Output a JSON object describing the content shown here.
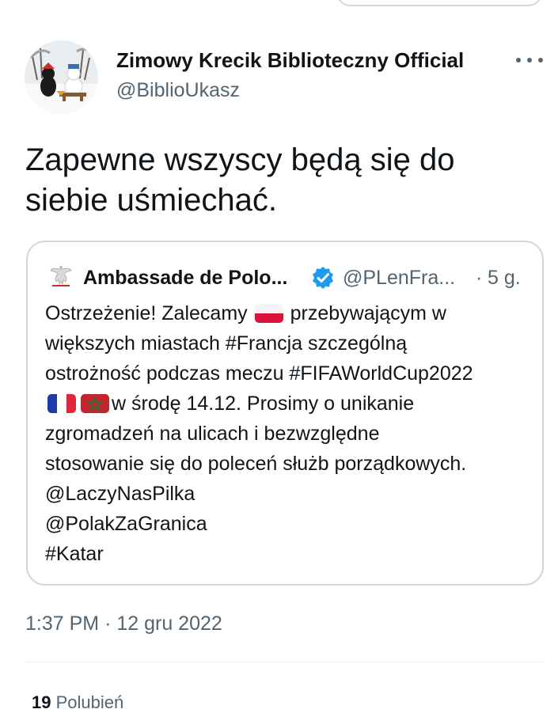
{
  "tweet": {
    "display_name": "Zimowy Krecik Biblioteczny Official",
    "handle": "@BiblioUkasz",
    "text": "Zapewne wszyscy będą się do siebie uśmiechać.",
    "time": "1:37 PM",
    "separator": "·",
    "date": "12 gru 2022",
    "likes_count": "19",
    "likes_label": "Polubień"
  },
  "quoted": {
    "display_name": "Ambassade de Polo...",
    "handle": "@PLenFra...",
    "separator": "·",
    "time": "5 g.",
    "lines": [
      {
        "pre": "Ostrzeżenie! Zalecamy",
        "post": "przebywającym w"
      },
      {
        "text": "większych miastach #Francja szczególną"
      },
      {
        "text": "ostrożność podczas meczu #FIFAWorldCup2022"
      },
      {
        "post": "w środę 14.12. Prosimy o unikanie"
      },
      {
        "text": "zgromadzeń na ulicach i bezwzględne"
      },
      {
        "text": "stosowanie się do poleceń służb porządkowych."
      },
      {
        "text": "@LaczyNasPilka"
      },
      {
        "text": "@PolakZaGranica"
      },
      {
        "text": "#Katar"
      }
    ]
  },
  "icons": {
    "more": "more-horizontal-icon",
    "verified": "verified-badge-icon",
    "emblem": "polish-eagle-emblem-icon",
    "flags": [
      "flag-poland",
      "flag-france",
      "flag-morocco"
    ]
  },
  "colors": {
    "text_primary": "#0f1419",
    "text_secondary": "#536471",
    "verified_blue": "#1d9bf0",
    "border": "#cfd9de"
  }
}
